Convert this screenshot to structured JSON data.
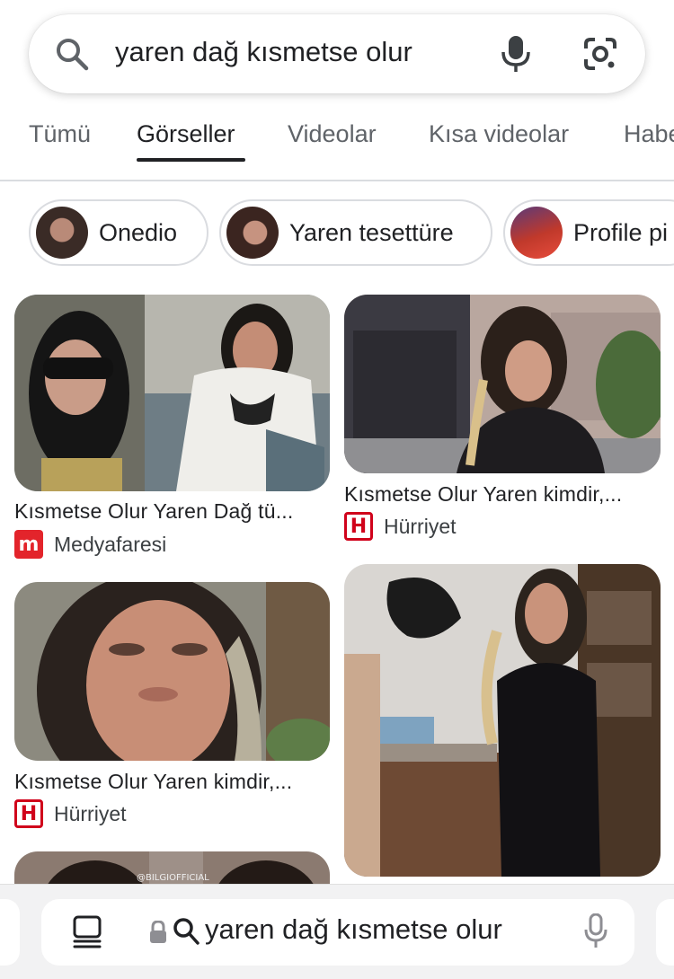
{
  "search": {
    "query": "yaren dağ kısmetse olur",
    "icons": {
      "search": "search-icon",
      "mic": "microphone-icon",
      "lens": "google-lens-icon"
    }
  },
  "tabs": [
    {
      "label": "Tümü",
      "active": false
    },
    {
      "label": "Görseller",
      "active": true
    },
    {
      "label": "Videolar",
      "active": false
    },
    {
      "label": "Kısa videolar",
      "active": false
    },
    {
      "label": "Haberler",
      "active": false
    }
  ],
  "chips": [
    {
      "label": "Onedio"
    },
    {
      "label": "Yaren tesettüre"
    },
    {
      "label": "Profile pi"
    }
  ],
  "results": [
    {
      "title": "Kısmetse Olur Yaren Dağ tü...",
      "source": "Medyafaresi",
      "favicon_letter": "m"
    },
    {
      "title": "Kısmetse Olur Yaren kimdir,...",
      "source": "Hürriyet",
      "favicon_letter": "H"
    },
    {
      "title": "Kısmetse Olur Yaren kimdir,...",
      "source": "Hürriyet",
      "favicon_letter": "H"
    }
  ],
  "image_overlay": "@BILGIOFFICIAL",
  "bottom_bar": {
    "url": "yaren dağ kısmetse olur",
    "icons": {
      "tabs": "tab-overview-icon",
      "lock": "lock-icon",
      "search": "search-icon",
      "mic": "microphone-icon"
    }
  },
  "colors": {
    "text": "#202124",
    "muted": "#5f6368",
    "divider": "#dadce0",
    "medyafaresi_red": "#e3242b",
    "hurriyet_red": "#d0021b"
  }
}
